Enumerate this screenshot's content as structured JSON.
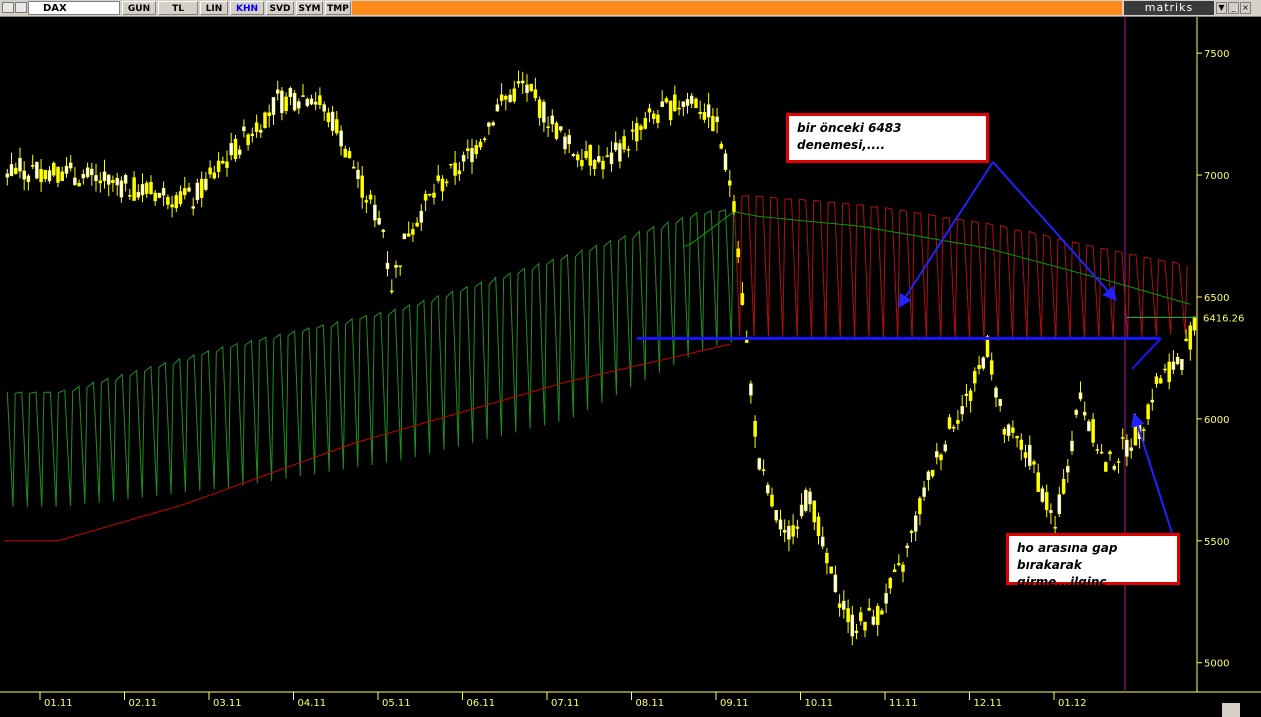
{
  "toolbar": {
    "symbol": "DAX",
    "buttons": [
      "GUN",
      "TL",
      "LIN",
      "KHN",
      "SVD",
      "SYM",
      "TMP"
    ],
    "active": "KHN",
    "brand": "matriks"
  },
  "chart_data": {
    "type": "candlestick",
    "x_tick_labels": [
      "01.11",
      "02.11",
      "03.11",
      "04.11",
      "05.11",
      "06.11",
      "07.11",
      "08.11",
      "09.11",
      "10.11",
      "11.11",
      "12.11",
      "01.12"
    ],
    "y_tick_labels": [
      5000,
      5500,
      6000,
      6500,
      7000,
      7500
    ],
    "ylim": [
      4880,
      7640
    ],
    "last_price_label": "6416.26",
    "last_price": 6416.26,
    "price_path": [
      [
        0,
        7020
      ],
      [
        0.8,
        6950
      ],
      [
        1.6,
        6900
      ],
      [
        2.2,
        7150
      ],
      [
        2.6,
        7300
      ],
      [
        3.0,
        7330
      ],
      [
        3.3,
        7200
      ],
      [
        3.6,
        6950
      ],
      [
        3.85,
        6780
      ],
      [
        3.95,
        6550
      ],
      [
        4.15,
        6780
      ],
      [
        4.5,
        6950
      ],
      [
        4.8,
        7050
      ],
      [
        5.0,
        7150
      ],
      [
        5.2,
        7280
      ],
      [
        5.5,
        7370
      ],
      [
        5.7,
        7280
      ],
      [
        6.1,
        7100
      ],
      [
        6.5,
        7050
      ],
      [
        7.0,
        7230
      ],
      [
        7.5,
        7320
      ],
      [
        7.8,
        7200
      ],
      [
        8.0,
        6900
      ],
      [
        8.15,
        6300
      ],
      [
        8.3,
        5800
      ],
      [
        8.6,
        5500
      ],
      [
        8.9,
        5700
      ],
      [
        9.1,
        5400
      ],
      [
        9.4,
        5150
      ],
      [
        9.7,
        5200
      ],
      [
        10.0,
        5400
      ],
      [
        10.3,
        5750
      ],
      [
        10.6,
        6000
      ],
      [
        10.8,
        6100
      ],
      [
        11.0,
        6300
      ],
      [
        11.2,
        5950
      ],
      [
        11.5,
        5850
      ],
      [
        11.8,
        5550
      ],
      [
        12.1,
        6100
      ],
      [
        12.4,
        5800
      ],
      [
        12.8,
        5950
      ],
      [
        13.0,
        6150
      ],
      [
        13.3,
        6250
      ],
      [
        13.5,
        6416.26
      ]
    ],
    "ma_long_path": [
      [
        0,
        5500
      ],
      [
        1.5,
        5650
      ],
      [
        3.5,
        5900
      ],
      [
        6.0,
        6150
      ],
      [
        8.0,
        6310
      ],
      [
        10.0,
        6290
      ],
      [
        12.0,
        6230
      ],
      [
        13.5,
        6190
      ]
    ],
    "ma_mid_path": [
      [
        0,
        6080
      ],
      [
        2.0,
        6200
      ],
      [
        4.0,
        6320
      ],
      [
        6.0,
        6500
      ],
      [
        7.5,
        6720
      ],
      [
        8.0,
        6850
      ],
      [
        8.3,
        6830
      ],
      [
        9.5,
        6790
      ],
      [
        11.0,
        6700
      ],
      [
        12.5,
        6560
      ],
      [
        13.5,
        6460
      ]
    ],
    "band_green_upper": [
      [
        0,
        6110
      ],
      [
        2.0,
        6300
      ],
      [
        4.0,
        6450
      ],
      [
        6.0,
        6670
      ],
      [
        7.6,
        6850
      ],
      [
        8.0,
        6860
      ]
    ],
    "band_green_lower": [
      [
        0,
        5640
      ],
      [
        2.0,
        5720
      ],
      [
        4.0,
        5830
      ],
      [
        6.0,
        6000
      ],
      [
        7.6,
        6290
      ],
      [
        8.0,
        6320
      ]
    ],
    "band_red_upper": [
      [
        8.0,
        6920
      ],
      [
        9.5,
        6880
      ],
      [
        11.0,
        6800
      ],
      [
        12.5,
        6690
      ],
      [
        13.3,
        6630
      ]
    ],
    "band_red_lower": [
      [
        8.0,
        6340
      ],
      [
        9.5,
        6330
      ],
      [
        11.0,
        6320
      ],
      [
        12.5,
        6330
      ],
      [
        13.3,
        6350
      ]
    ],
    "support_line": {
      "value": 6330,
      "x_from": 6.85,
      "x_to": 13.05
    },
    "annotations": [
      {
        "id": "note1",
        "text_lines": [
          "bir önceki 6483",
          "denemesi,...."
        ]
      },
      {
        "id": "note2",
        "text_lines": [
          "ho arasına gap",
          "bırakarak girme...ilginç"
        ]
      }
    ],
    "colors": {
      "bull": "#ffff00",
      "bear": "#ffffff",
      "ma_long": "#cc0000",
      "ma_mid": "#00a000",
      "band_green": "#1f8f1f",
      "band_red": "#b01010",
      "support": "#1515ff",
      "arrows": "#2222ff",
      "marker": "#a020a0",
      "axis_text": "#ffff66",
      "background": "#000000"
    }
  }
}
